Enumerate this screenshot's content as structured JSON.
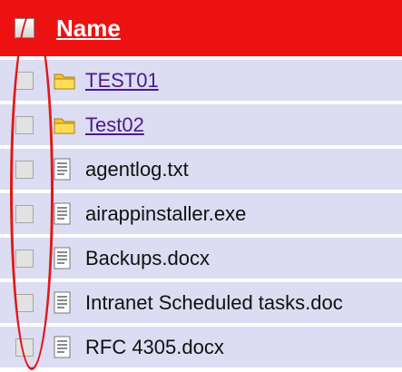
{
  "header": {
    "name_label": "Name",
    "background": "#ee1111"
  },
  "rows": [
    {
      "name": "TEST01",
      "type": "folder",
      "icon": "folder-icon"
    },
    {
      "name": "Test02",
      "type": "folder",
      "icon": "folder-icon"
    },
    {
      "name": "agentlog.txt",
      "type": "file",
      "icon": "document-icon"
    },
    {
      "name": "airappinstaller.exe",
      "type": "file",
      "icon": "document-icon"
    },
    {
      "name": "Backups.docx",
      "type": "file",
      "icon": "document-icon"
    },
    {
      "name": "Intranet Scheduled tasks.doc",
      "type": "file",
      "icon": "document-icon"
    },
    {
      "name": "RFC 4305.docx",
      "type": "file",
      "icon": "document-icon"
    }
  ],
  "colors": {
    "row_background": "#dcdcf2",
    "folder_link": "#4b1a8a",
    "annotation_oval": "#e01818"
  }
}
